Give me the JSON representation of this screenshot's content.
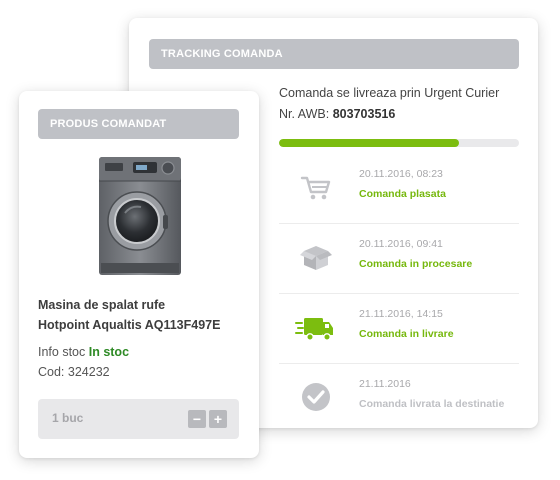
{
  "tracking": {
    "header": "TRACKING COMANDA",
    "delivery_text": "Comanda se livreaza prin Urgent Curier",
    "awb_label": "Nr. AWB:",
    "awb_number": "803703516",
    "progress": 0.75,
    "colors": {
      "accent": "#7cbd0f",
      "pending": "#bfc0c4",
      "header_bg": "#bfc1c6"
    },
    "steps": [
      {
        "date": "20.11.2016, 08:23",
        "status": "Comanda plasata",
        "icon": "cart-icon",
        "done": true
      },
      {
        "date": "20.11.2016, 09:41",
        "status": "Comanda in procesare",
        "icon": "box-icon",
        "done": true
      },
      {
        "date": "21.11.2016, 14:15",
        "status": "Comanda in livrare",
        "icon": "delivery-truck-icon",
        "done": true
      },
      {
        "date": "21.11.2016",
        "status": "Comanda livrata la destinatie",
        "icon": "checkmark-circle-icon",
        "done": false
      }
    ]
  },
  "product": {
    "header": "PRODUS COMANDAT",
    "image_icon": "washing-machine-icon",
    "name_line1": "Masina de spalat rufe",
    "name_line2": "Hotpoint Aqualtis AQ113F497E",
    "stock_label": "Info stoc",
    "stock_value": "In stoc",
    "code_label": "Cod:",
    "code_value": "324232",
    "quantity": "1 buc",
    "minus_label": "−",
    "plus_label": "+",
    "colors": {
      "stock": "#2e8a25"
    }
  }
}
